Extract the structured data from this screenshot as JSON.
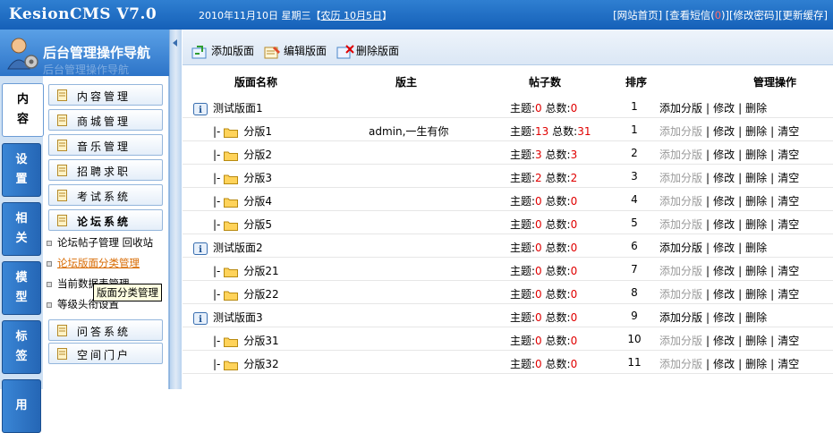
{
  "app": {
    "logo": "KesionCMS V7.0"
  },
  "topbar": {
    "date_text": "2010年11月10日 星期三【",
    "lunar": "农历 10月5日",
    "date_end": "】",
    "links": {
      "home": "[网站首页]",
      "msg_pre": "[查看短信(",
      "msg_count": "0",
      "msg_post": ")]",
      "password": "[修改密码]",
      "cache": "[更新缓存]"
    }
  },
  "sidebar": {
    "title": "后台管理操作导航",
    "ghost_text": "后台管理操作导航",
    "vtabs": [
      {
        "label": "内\n容",
        "active": true
      },
      {
        "label": "设\n置",
        "active": false
      },
      {
        "label": "相\n关",
        "active": false
      },
      {
        "label": "模\n型",
        "active": false
      },
      {
        "label": "标\n签",
        "active": false
      },
      {
        "label": "用",
        "active": false
      }
    ],
    "menu": [
      {
        "label": "内容管理"
      },
      {
        "label": "商城管理"
      },
      {
        "label": "音乐管理"
      },
      {
        "label": "招聘求职"
      },
      {
        "label": "考试系统"
      },
      {
        "label": "论坛系统",
        "bold": true
      },
      {
        "label": "问答系统"
      },
      {
        "label": "空间门户"
      }
    ],
    "forum_sub": {
      "item1a": "论坛帖子管理",
      "item1b": "回收站",
      "item2": "论坛版面分类管理",
      "item3": "当前数据表管理",
      "item4": "等级头衔设置"
    },
    "tooltip": "版面分类管理"
  },
  "toolbar": {
    "add": "添加版面",
    "edit": "编辑版面",
    "delete": "删除版面"
  },
  "table": {
    "headers": {
      "name": "版面名称",
      "owner": "版主",
      "posts": "帖子数",
      "order": "排序",
      "ops": "管理操作"
    },
    "topic_label": "主题:",
    "total_label": "总数:",
    "ops": {
      "add_sub": "添加分版",
      "edit": "修改",
      "delete": "删除",
      "clear": "清空"
    },
    "rows": [
      {
        "name": "测试版面1",
        "level": 0,
        "owner": "",
        "topics": "0",
        "total": "0",
        "order": "1"
      },
      {
        "name": "分版1",
        "level": 1,
        "owner": "admin,一生有你",
        "topics": "13",
        "total": "31",
        "order": "1"
      },
      {
        "name": "分版2",
        "level": 1,
        "owner": "",
        "topics": "3",
        "total": "3",
        "order": "2"
      },
      {
        "name": "分版3",
        "level": 1,
        "owner": "",
        "topics": "2",
        "total": "2",
        "order": "3"
      },
      {
        "name": "分版4",
        "level": 1,
        "owner": "",
        "topics": "0",
        "total": "0",
        "order": "4"
      },
      {
        "name": "分版5",
        "level": 1,
        "owner": "",
        "topics": "0",
        "total": "0",
        "order": "5"
      },
      {
        "name": "测试版面2",
        "level": 0,
        "owner": "",
        "topics": "0",
        "total": "0",
        "order": "6"
      },
      {
        "name": "分版21",
        "level": 1,
        "owner": "",
        "topics": "0",
        "total": "0",
        "order": "7"
      },
      {
        "name": "分版22",
        "level": 1,
        "owner": "",
        "topics": "0",
        "total": "0",
        "order": "8"
      },
      {
        "name": "测试版面3",
        "level": 0,
        "owner": "",
        "topics": "0",
        "total": "0",
        "order": "9"
      },
      {
        "name": "分版31",
        "level": 1,
        "owner": "",
        "topics": "0",
        "total": "0",
        "order": "10"
      },
      {
        "name": "分版32",
        "level": 1,
        "owner": "",
        "topics": "0",
        "total": "0",
        "order": "11"
      }
    ]
  },
  "colors": {
    "topbar": "#1f6cc4",
    "accent_red": "#e00000",
    "selected_link": "#d86a00",
    "disabled": "#9a9a9a"
  }
}
